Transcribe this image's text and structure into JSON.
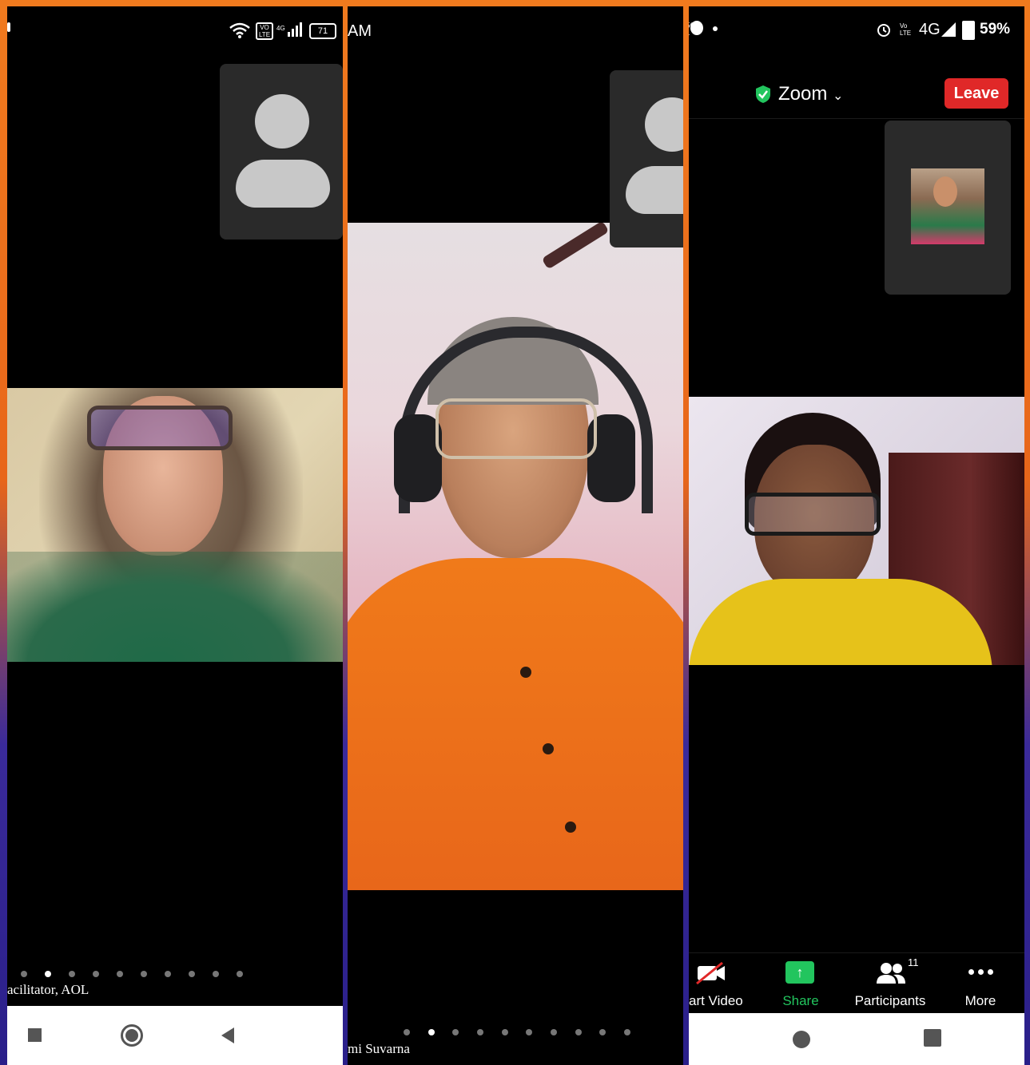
{
  "panel1": {
    "status_icons": [
      "wifi-icon",
      "volte-icon",
      "signal-icon",
      "battery-icon"
    ],
    "battery_text": "71",
    "caption": "acilitator, AOL",
    "page_dots": 10,
    "active_dot": 1
  },
  "panel2": {
    "status_time_fragment": "AM",
    "caption": "mi Suvarna",
    "page_dots": 10,
    "active_dot": 1
  },
  "panel3": {
    "status_right": {
      "network": "4G",
      "battery": "59%"
    },
    "meeting_title": "Zoom",
    "leave_label": "Leave",
    "toolbar": [
      {
        "label": "art Video",
        "icon": "video-off-icon"
      },
      {
        "label": "Share",
        "icon": "share-icon"
      },
      {
        "label": "Participants",
        "icon": "participants-icon",
        "badge": "11"
      },
      {
        "label": "More",
        "icon": "more-icon"
      }
    ],
    "colors": {
      "leave": "#e02828",
      "share": "#22c55e",
      "shield": "#22c55e"
    }
  }
}
